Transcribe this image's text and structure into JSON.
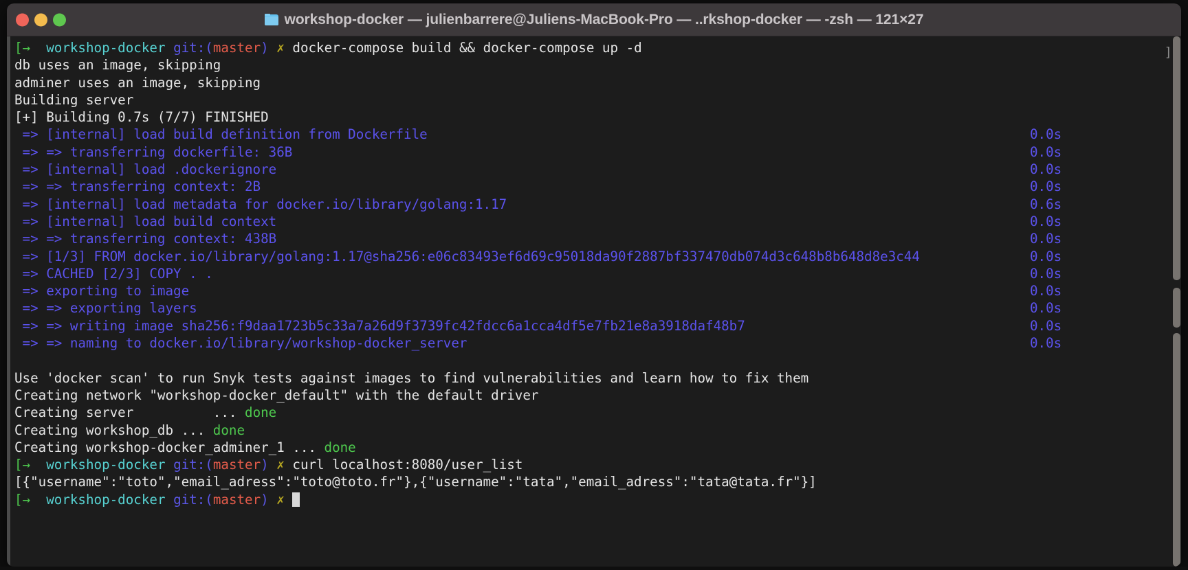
{
  "window": {
    "title": "workshop-docker — julienbarrere@Juliens-MacBook-Pro — ..rkshop-docker — -zsh — 121×27",
    "folder_icon": "folder-icon",
    "traffic_lights": {
      "close": "close-button",
      "minimize": "minimize-button",
      "zoom": "zoom-button"
    },
    "colors": {
      "titlebar_bg": "#3d393b",
      "terminal_bg": "#1c1c1c",
      "text": "#e6e6e6",
      "build_purple": "#5b52ec",
      "prompt_cyan": "#57d2d2",
      "prompt_red": "#e35b4a",
      "prompt_green": "#4ec94e",
      "prompt_yellow": "#b5a521",
      "done_green": "#4ec94e"
    }
  },
  "terminal": {
    "prompt": {
      "arrow": "[→",
      "repo": "workshop-docker",
      "git_prefix": "git:",
      "paren_open": "(",
      "branch": "master",
      "paren_close": ")",
      "dirty_mark": "✗"
    },
    "commands": {
      "first": "docker-compose build && docker-compose up -d",
      "second": "curl localhost:8080/user_list",
      "third": ""
    },
    "compose_skip": [
      "db uses an image, skipping",
      "adminer uses an image, skipping",
      "Building server"
    ],
    "build_header": "[+] Building 0.7s (7/7) FINISHED",
    "build_steps": [
      {
        "text": " => [internal] load build definition from Dockerfile",
        "secs": "0.0s"
      },
      {
        "text": " => => transferring dockerfile: 36B",
        "secs": "0.0s"
      },
      {
        "text": " => [internal] load .dockerignore",
        "secs": "0.0s"
      },
      {
        "text": " => => transferring context: 2B",
        "secs": "0.0s"
      },
      {
        "text": " => [internal] load metadata for docker.io/library/golang:1.17",
        "secs": "0.6s"
      },
      {
        "text": " => [internal] load build context",
        "secs": "0.0s"
      },
      {
        "text": " => => transferring context: 438B",
        "secs": "0.0s"
      },
      {
        "text": " => [1/3] FROM docker.io/library/golang:1.17@sha256:e06c83493ef6d69c95018da90f2887bf337470db074d3c648b8b648d8e3c44",
        "secs": "0.0s"
      },
      {
        "text": " => CACHED [2/3] COPY . .",
        "secs": "0.0s"
      },
      {
        "text": " => exporting to image",
        "secs": "0.0s"
      },
      {
        "text": " => => exporting layers",
        "secs": "0.0s"
      },
      {
        "text": " => => writing image sha256:f9daa1723b5c33a7a26d9f3739fc42fdcc6a1cca4df5e7fb21e8a3918daf48b7",
        "secs": "0.0s"
      },
      {
        "text": " => => naming to docker.io/library/workshop-docker_server",
        "secs": "0.0s"
      }
    ],
    "scan_hint": "Use 'docker scan' to run Snyk tests against images to find vulnerabilities and learn how to fix them",
    "network_line": "Creating network \"workshop-docker_default\" with the default driver",
    "creating": [
      {
        "label": "Creating server          ... ",
        "status": "done"
      },
      {
        "label": "Creating workshop_db ... ",
        "status": "done"
      },
      {
        "label": "Creating workshop-docker_adminer_1 ... ",
        "status": "done"
      }
    ],
    "curl_response": "[{\"username\":\"toto\",\"email_adress\":\"toto@toto.fr\"},{\"username\":\"tata\",\"email_adress\":\"tata@tata.fr\"}]",
    "right_edge_marker": "]"
  }
}
